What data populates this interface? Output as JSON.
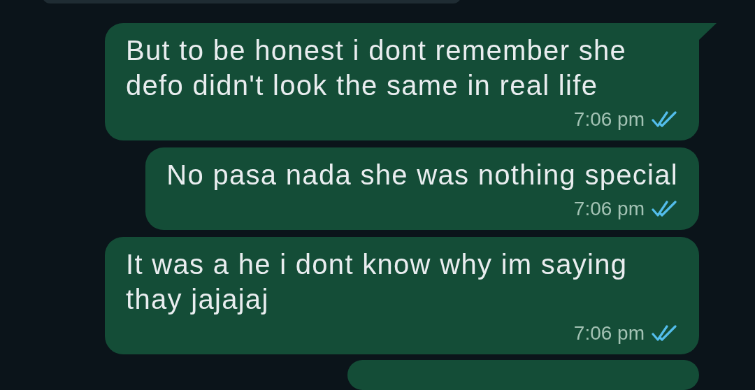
{
  "messages": [
    {
      "text": "But to be honest i dont remember she defo didn't look the same in real life",
      "time": "7:06 pm",
      "read": true,
      "tail": true
    },
    {
      "text": "No pasa nada she was nothing special",
      "time": "7:06 pm",
      "read": true,
      "tail": false
    },
    {
      "text": "It was a he i dont know why im saying thay jajajaj",
      "time": "7:06 pm",
      "read": true,
      "tail": false
    }
  ]
}
